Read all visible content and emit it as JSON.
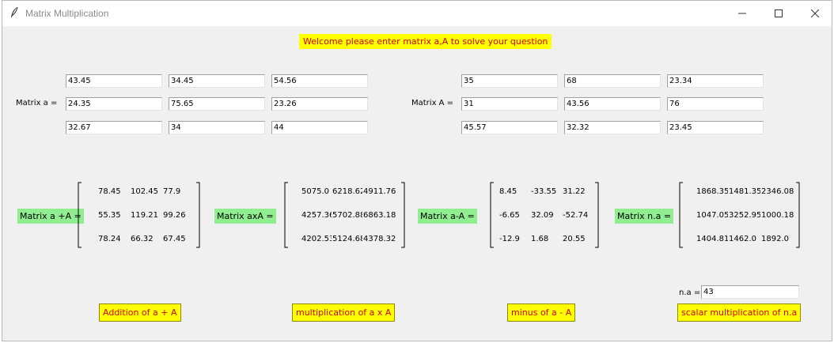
{
  "window": {
    "title": "Matrix Multiplication",
    "icon": "feather-icon"
  },
  "banner": "Welcome please enter matrix a,A to solve your question",
  "matrix_a": {
    "label": "Matrix a =",
    "rows": [
      [
        "43.45",
        "34.45",
        "54.56"
      ],
      [
        "24.35",
        "75.65",
        "23.26"
      ],
      [
        "32.67",
        "34",
        "44"
      ]
    ]
  },
  "matrix_A": {
    "label": "Matrix A =",
    "rows": [
      [
        "35",
        "68",
        "23.34"
      ],
      [
        "31",
        "43.56",
        "76"
      ],
      [
        "45.57",
        "32.32",
        "23.45"
      ]
    ]
  },
  "results": {
    "add": {
      "label": "Matrix a +A =",
      "rows": [
        [
          "78.45",
          "102.45",
          "77.9"
        ],
        [
          "55.35",
          "119.21",
          "99.26"
        ],
        [
          "78.24",
          "66.32",
          "67.45"
        ]
      ]
    },
    "mul": {
      "label": "Matrix axA =",
      "rows": [
        [
          "5075.0",
          "6218.62",
          "4911.76"
        ],
        [
          "4257.36",
          "5702.88",
          "6863.18"
        ],
        [
          "4202.53",
          "5124.68",
          "4378.32"
        ]
      ]
    },
    "sub": {
      "label": "Matrix a-A =",
      "rows": [
        [
          "8.45",
          "-33.55",
          "31.22"
        ],
        [
          "-6.65",
          "32.09",
          "-52.74"
        ],
        [
          "-12.9",
          "1.68",
          "20.55"
        ]
      ]
    },
    "scalar": {
      "label": "Matrix n.a =",
      "rows": [
        [
          "1868.35",
          "1481.35",
          "2346.08"
        ],
        [
          "1047.05",
          "3252.95",
          "1000.18"
        ],
        [
          "1404.81",
          "1462.0",
          "1892.0"
        ]
      ]
    }
  },
  "scalar_input": {
    "label": "n.a =",
    "value": "43"
  },
  "buttons": {
    "add": "Addition of a + A",
    "mul": "multiplication of a x A",
    "sub": "minus of a - A",
    "scalar": "scalar multiplication of n.a"
  },
  "colors": {
    "banner_bg": "#ffff00",
    "banner_text": "#d40000",
    "result_label_bg": "#90ee90"
  }
}
